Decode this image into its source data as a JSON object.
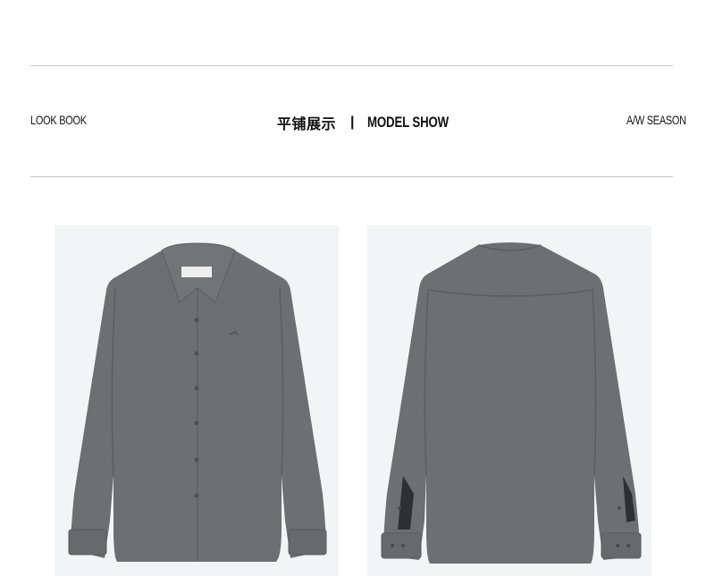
{
  "header": {
    "left_label": "LOOK BOOK",
    "center_cn": "平铺展示",
    "separator": "|",
    "center_en": "MODEL SHOW",
    "right_label": "A/W SEASON"
  },
  "colors": {
    "shirt": "#6e6f72",
    "shirt_shadow": "#5c5d60",
    "photo_bg": "#f3f4f6",
    "rule": "#c8c8c8"
  },
  "images": {
    "front": "grey-shirt-front",
    "back": "grey-shirt-back"
  }
}
